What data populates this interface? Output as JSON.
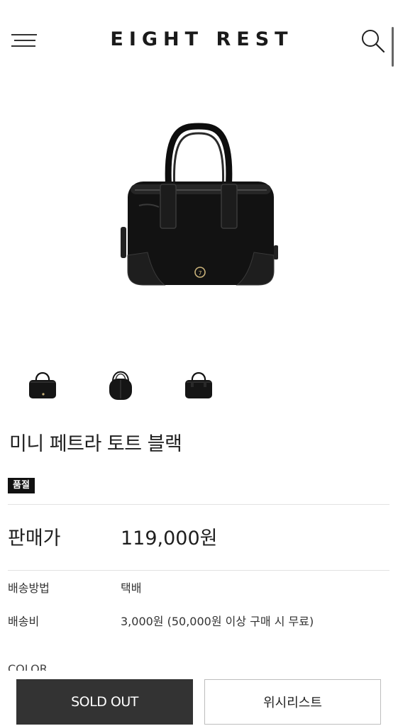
{
  "header": {
    "logo": "EIGHT REST"
  },
  "product": {
    "title": "미니 페트라 토트 블랙",
    "badge": "품절",
    "price_label": "판매가",
    "price_value": "119,000원",
    "thumbnails": [
      "front",
      "side",
      "back"
    ]
  },
  "info": [
    {
      "label": "배송방법",
      "value": "택배"
    },
    {
      "label": "배송비",
      "value": "3,000원 (50,000원 이상 구매 시 무료)"
    }
  ],
  "color_label": "COLOR",
  "actions": {
    "soldout_label": "SOLD OUT",
    "wishlist_label": "위시리스트"
  },
  "colors": {
    "soldout_bg": "#333333",
    "badge_bg": "#111111"
  },
  "icons": {
    "menu": "hamburger-menu-icon",
    "search": "search-icon"
  }
}
